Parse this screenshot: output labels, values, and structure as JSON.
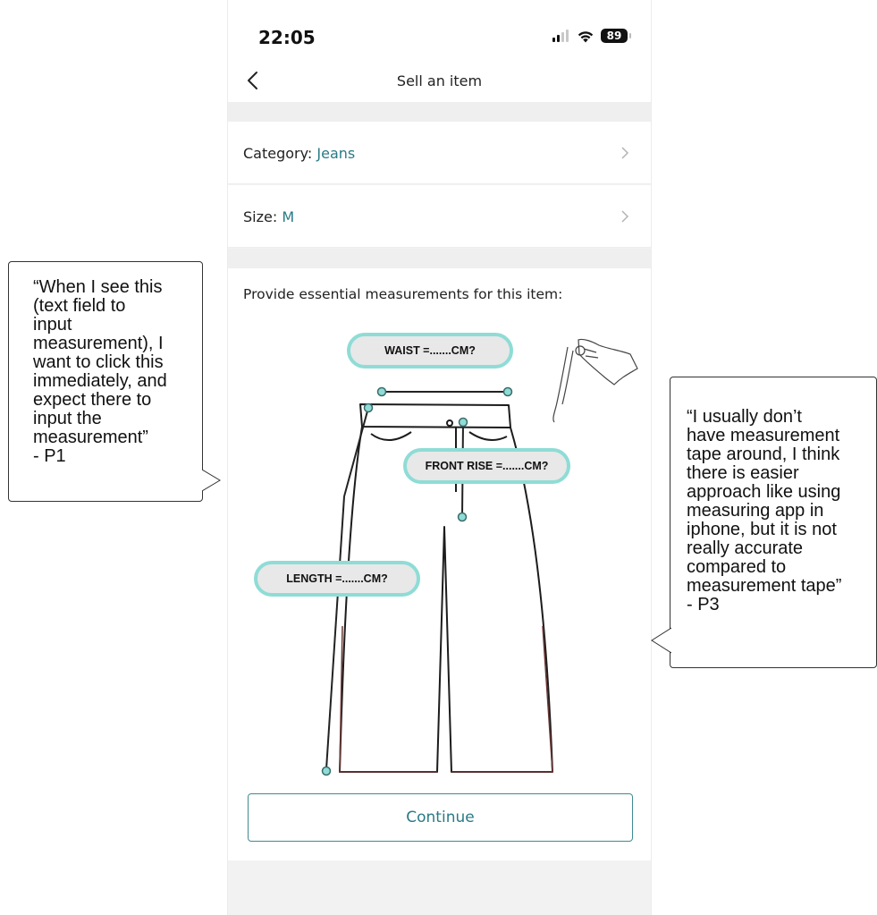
{
  "status_bar": {
    "time": "22:05",
    "battery": "89"
  },
  "nav": {
    "title": "Sell an item"
  },
  "rows": [
    {
      "label": "Category: ",
      "value": "Jeans"
    },
    {
      "label": "Size: ",
      "value": "M"
    }
  ],
  "measurements": {
    "prompt": "Provide essential measurements for this item:",
    "waist_label": "WAIST =.......CM?",
    "front_rise_label": "FRONT RISE  =.......CM?",
    "length_label": "LENGTH  =.......CM?"
  },
  "continue_label": "Continue",
  "annotations": {
    "p1": "“When I see this\n(text field to\ninput\nmeasurement), I\nwant to click this\nimmediately, and\nexpect there to\ninput the\nmeasurement”\n- P1",
    "p3": "“I usually don’t\nhave measurement\ntape around, I think\nthere is easier\napproach like using\nmeasuring app in\niphone, but it is not\nreally accurate\ncompared to\nmeasurement tape”\n- P3"
  },
  "colors": {
    "accent": "#2a7a86",
    "pill_border": "#8fdcd6",
    "dot": "#8fdcd6"
  }
}
